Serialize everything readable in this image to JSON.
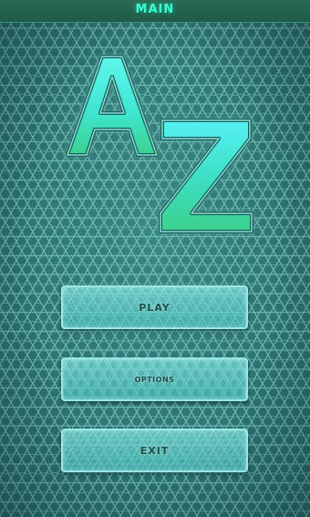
{
  "header": {
    "title": "MAIN"
  },
  "logo": {
    "text": "AZ",
    "letters": [
      "A",
      "Z"
    ]
  },
  "menu": {
    "play_label": "PLAY",
    "options_label": "OPTIONS",
    "exit_label": "EXIT"
  },
  "colors": {
    "background": "#2c7270",
    "title_text": "#3cffd0",
    "logo_top": "#45f2e6",
    "logo_bottom": "#3cd28c",
    "button_border": "#9ae8e6",
    "button_text": "#1a4d48"
  }
}
